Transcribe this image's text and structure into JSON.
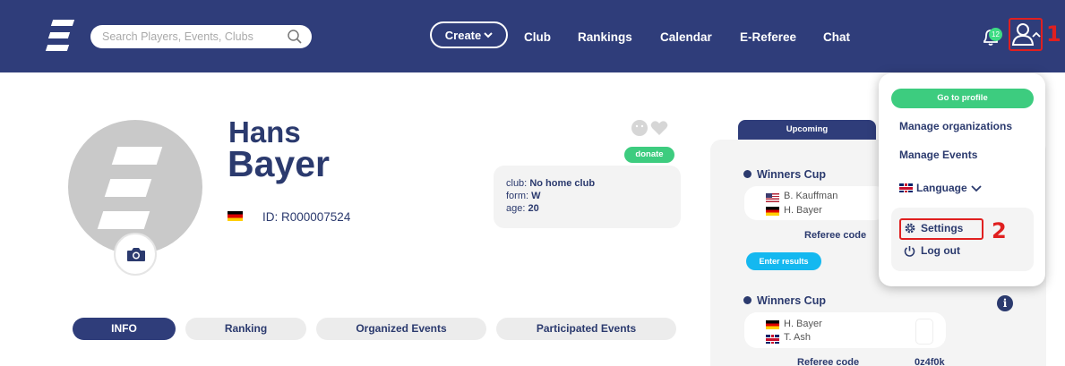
{
  "header": {
    "search": {
      "placeholder": "Search Players, Events, Clubs"
    },
    "create_label": "Create",
    "nav": [
      "Club",
      "Rankings",
      "Calendar",
      "E-Referee",
      "Chat"
    ],
    "notification_count": "12",
    "annotation_1": "1",
    "annotation_2": "2"
  },
  "profile": {
    "first_name": "Hans",
    "last_name": "Bayer",
    "id_text": "ID: R000007524",
    "donate_label": "donate",
    "info": {
      "club_label": "club:",
      "club_value": "No home club",
      "form_label": "form:",
      "form_value": "W",
      "age_label": "age:",
      "age_value": "20"
    }
  },
  "tabs": [
    "INFO",
    "Ranking",
    "Organized Events",
    "Participated Events"
  ],
  "events": {
    "tab_label": "Upcoming",
    "items": [
      {
        "title": "Winners Cup",
        "player1": "B. Kauffman",
        "player2": "H. Bayer",
        "referee_label": "Referee code",
        "action": "Enter results"
      },
      {
        "title": "Winners Cup",
        "player1": "H. Bayer",
        "player2": "T. Ash",
        "referee_label": "Referee code",
        "referee_code": "0z4f0k"
      }
    ]
  },
  "dropdown": {
    "go_to_profile": "Go to profile",
    "manage_organizations": "Manage organizations",
    "manage_events": "Manage Events",
    "language": "Language",
    "settings": "Settings",
    "log_out": "Log out"
  },
  "colors": {
    "navy": "#2f3d7a",
    "green": "#3dcc7f",
    "cyan": "#14b8f0",
    "annotation_red": "#e02020"
  }
}
